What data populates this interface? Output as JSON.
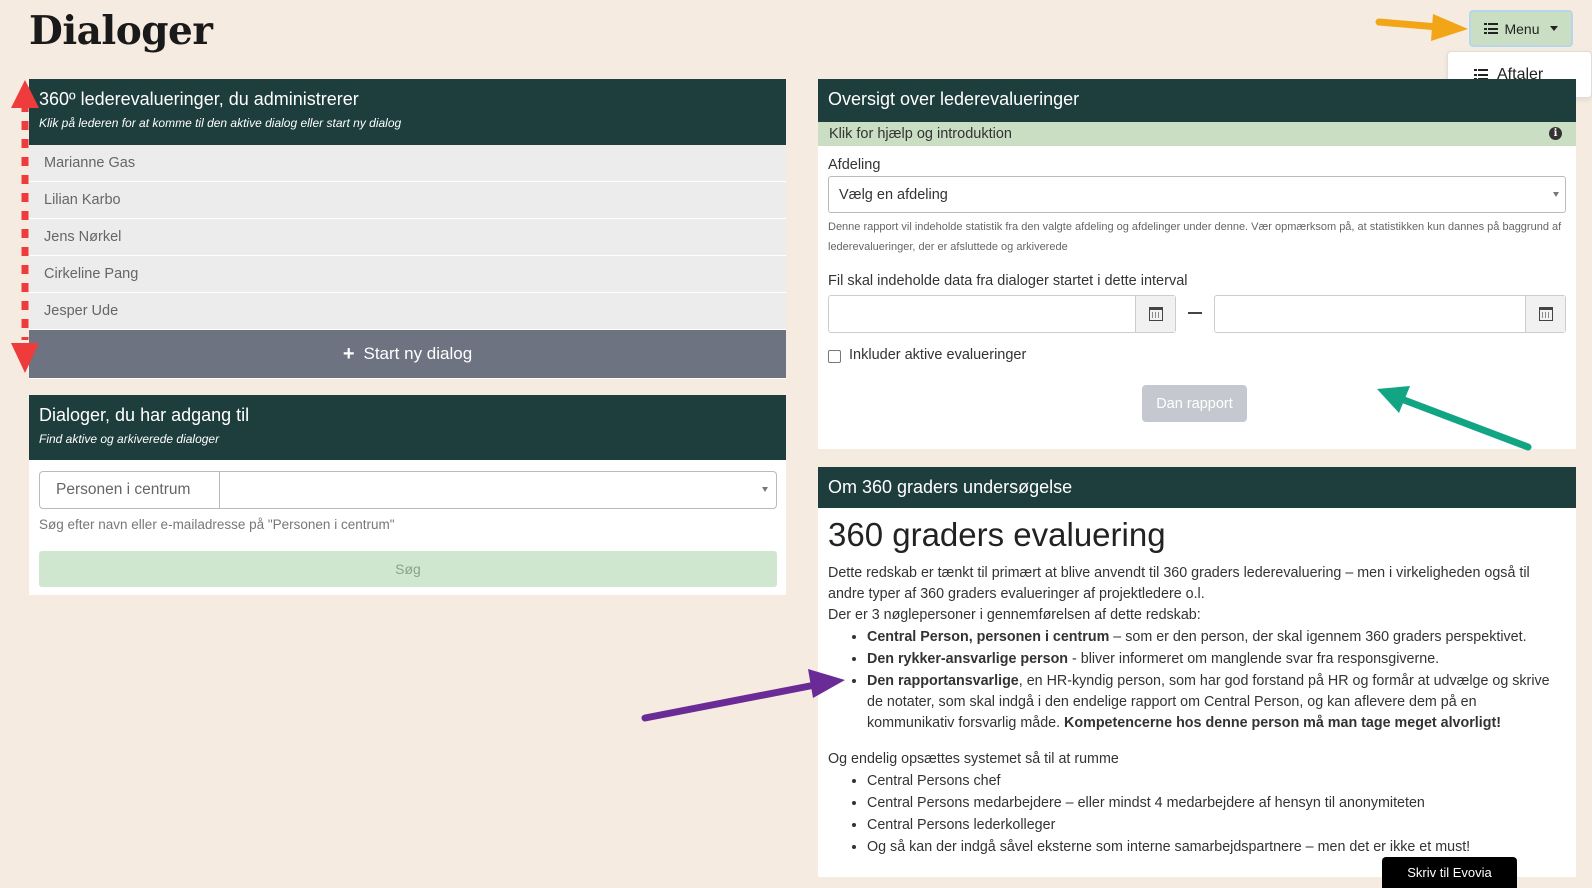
{
  "page": {
    "title": "Dialoger"
  },
  "menu": {
    "label": "Menu",
    "dropdown_item": "Aftaler"
  },
  "lead_card": {
    "title": "360º lederevalueringer, du administrerer",
    "subtitle": "Klik på lederen for at komme til den aktive dialog eller start ny dialog",
    "leaders": [
      "Marianne Gas",
      "Lilian Karbo",
      "Jens Nørkel",
      "Cirkeline Pang",
      "Jesper Ude"
    ],
    "start_label": "Start ny dialog"
  },
  "access_card": {
    "title": "Dialoger, du har adgang til",
    "subtitle": "Find aktive og arkiverede dialoger",
    "person_label": "Personen i centrum",
    "hint": "Søg efter navn eller e-mailadresse på \"Personen i centrum\"",
    "search_label": "Søg"
  },
  "overview_card": {
    "title": "Oversigt over lederevalueringer",
    "help": "Klik for hjælp og introduktion",
    "department_label": "Afdeling",
    "department_selected": "Vælg en afdeling",
    "note": "Denne rapport vil indeholde statistik fra den valgte afdeling og afdelinger under denne. Vær opmærksom på, at statistikken kun dannes på baggrund af lederevalueringer, der er afsluttede og arkiverede",
    "interval_label": "Fil skal indeholde data fra dialoger startet i dette interval",
    "include_label": "Inkluder aktive evalueringer",
    "report_label": "Dan rapport"
  },
  "about_card": {
    "title": "Om 360 graders undersøgelse",
    "heading": "360 graders evaluering",
    "intro": "Dette redskab er tænkt til primært at blive anvendt til 360 graders lederevaluering – men i virkeligheden også til andre typer af 360 graders evalueringer af projektledere o.l.",
    "key_people_intro": "Der er 3 nøglepersoner i gennemførelsen af dette redskab:",
    "key_people": [
      {
        "bold": "Central Person, personen i centrum",
        "text": " – som er den person, der skal igennem 360 graders perspektivet."
      },
      {
        "bold": "Den rykker-ansvarlige person",
        "text": " - bliver informeret om manglende svar fra responsgiverne."
      },
      {
        "bold": "Den rapportansvarlige",
        "text": ", en HR-kyndig person, som har god forstand på HR og formår at udvælge og skrive de notater, som skal indgå i den endelige rapport om Central Person, og kan aflevere dem på en kommunikativ forsvarlig måde. ",
        "bold2": "Kompetencerne hos denne person må man tage meget alvorligt!"
      }
    ],
    "finally_intro": "Og endelig opsættes systemet så til at rumme",
    "finally_items": [
      "Central Persons chef",
      "Central Persons medarbejdere – eller mindst 4 medarbejdere af hensyn til anonymiteten",
      "Central Persons lederkolleger",
      "Og så kan der indgå såvel eksterne som interne samarbejdspartnere – men det er ikke et must!"
    ]
  },
  "footer": {
    "contact_label": "Skriv til Evovia"
  },
  "colors": {
    "header": "#1e3d3d",
    "background": "#f5ebe0",
    "help_bar": "#c9dec2",
    "start_button": "#6e7381"
  }
}
